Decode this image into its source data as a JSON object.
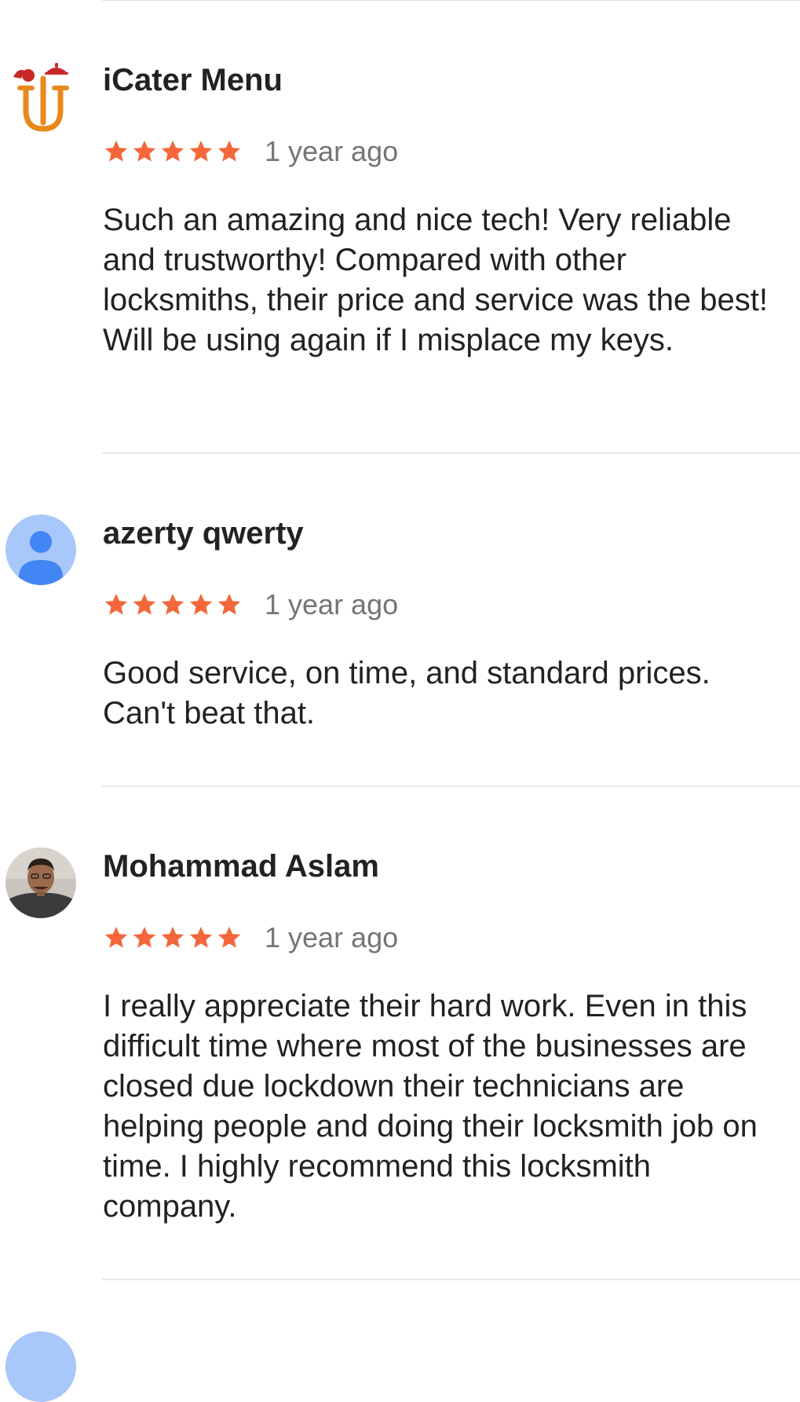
{
  "reviews": [
    {
      "name": "iCater Menu",
      "avatar": "icater-logo-icon",
      "rating": 5,
      "time": "1 year ago",
      "text": "Such an amazing and nice tech! Very reliable and trustworthy! Compared with other locksmiths, their price and service was the best! Will be using again if I misplace my keys."
    },
    {
      "name": "azerty qwerty",
      "avatar": "default-person-avatar-icon",
      "rating": 5,
      "time": "1 year ago",
      "text": "Good service, on time, and standard prices. Can't beat that."
    },
    {
      "name": "Mohammad Aslam",
      "avatar": "user-photo-avatar",
      "rating": 5,
      "time": "1 year ago",
      "text": "I really appreciate their hard work. Even in this difficult time where most of the businesses are closed due lockdown their technicians are helping people and doing their locksmith job on time. I highly recommend this locksmith company."
    }
  ],
  "colors": {
    "star": "#f4673a",
    "time": "#757575",
    "text": "#222222",
    "divider": "#e8e8e8",
    "default_avatar_bg": "#a8c7fa",
    "default_avatar_fg": "#4285f4",
    "logo_orange": "#e8891c",
    "logo_red": "#c62828"
  }
}
